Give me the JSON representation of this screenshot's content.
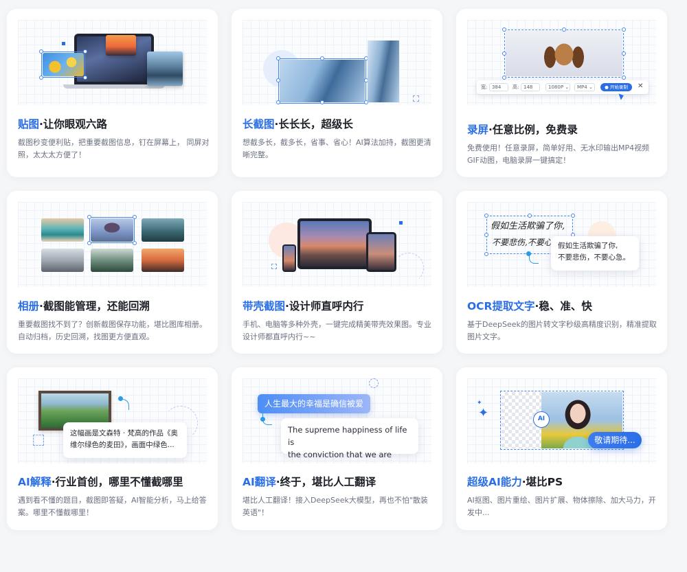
{
  "cards": [
    {
      "title_hl": "贴图",
      "title_rest": "·让你眼观六路",
      "desc": "截图秒变便利贴，把重要截图信息，钉在屏幕上， 同屏对照，太太太方便了！"
    },
    {
      "title_hl": "长截图",
      "title_rest": "·长长长，超级长",
      "desc": "想截多长，截多长，省事、省心！AI算法加持，截图更清晰完整。"
    },
    {
      "title_hl": "录屏",
      "title_rest": "·任意比例，免费录",
      "desc": "免费使用！任意录屏，简单好用、无水印输出MP4视频GIF动图，电脑录屏一键搞定！",
      "toolbar": {
        "width_label": "宽:",
        "width_value": "384",
        "height_label": "高:",
        "height_value": "148",
        "resolution": "1080P",
        "format": "MP4",
        "start_label": "开始录制"
      }
    },
    {
      "title_hl": "相册",
      "title_rest": "·截图能管理，还能回溯",
      "desc": "重要截图找不到了？创新截图保存功能，堪比图库相册。自动归档，历史回溯，找图更方便直观。"
    },
    {
      "title_hl": "带壳截图",
      "title_rest": "·设计师直呼内行",
      "desc": "手机、电脑等多种外壳，一键完成精美带壳效果图。专业设计师都直呼内行~~"
    },
    {
      "title_hl": "OCR提取文字",
      "title_rest": "·稳、准、快",
      "desc": "基于DeepSeek的图片转文字秒级高精度识别，精准提取图片文字。",
      "handwriting_line1": "假如生活欺骗了你,",
      "handwriting_line2": "不要悲伤,不要心急",
      "ocr_line1": "假如生活欺骗了你,",
      "ocr_line2": "不要悲伤，不要心急。"
    },
    {
      "title_hl": "AI解释",
      "title_rest": "·行业首创，哪里不懂截哪里",
      "desc": "遇到看不懂的题目，截图即答疑，AI智能分析，马上给答案。哪里不懂截哪里！",
      "bubble_line1": "这幅画是文森特 · 梵高的作品《奥",
      "bubble_line2": "维尔绿色的麦田》，画面中绿色..."
    },
    {
      "title_hl": "AI翻译",
      "title_rest": "·终于，堪比人工翻译",
      "desc": "堪比人工翻译！接入DeepSeek大模型，再也不怕\"散装英语\"！",
      "cn_text": "人生最大的幸福是确信被爱",
      "en_line1": "The supreme happiness of life is",
      "en_line2": "the conviction that we are loved"
    },
    {
      "title_hl": "超级AI能力",
      "title_rest": "·堪比PS",
      "desc": "AI抠图、图片重绘、图片扩展、物体擦除、加大马力，开发中...",
      "badge": "敬请期待...",
      "ai_mark": "AI"
    }
  ],
  "colors": {
    "accent": "#2a6ee6",
    "title": "#1c1f26",
    "desc": "#6b7180"
  }
}
